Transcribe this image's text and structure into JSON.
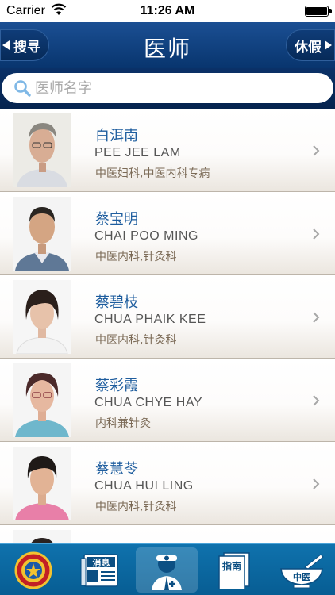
{
  "status_bar": {
    "carrier": "Carrier",
    "time": "11:26 AM"
  },
  "nav": {
    "title": "医师",
    "left_button": "搜寻",
    "right_button": "休假"
  },
  "search": {
    "placeholder": "医师名字",
    "value": ""
  },
  "doctors": [
    {
      "name": "白洱南",
      "pinyin": "PEE JEE LAM",
      "specialty": "中医妇科,中医内科专病"
    },
    {
      "name": "蔡宝明",
      "pinyin": "CHAI POO MING",
      "specialty": "中医内科,针灸科"
    },
    {
      "name": "蔡碧枝",
      "pinyin": "CHUA PHAIK KEE",
      "specialty": "中医内科,针灸科"
    },
    {
      "name": "蔡彩霞",
      "pinyin": "CHUA CHYE HAY",
      "specialty": "内科兼针灸"
    },
    {
      "name": "蔡慧苓",
      "pinyin": "CHUA HUI LING",
      "specialty": "中医内科,针灸科"
    }
  ],
  "tab_bar": {
    "tabs": [
      {
        "icon": "emblem-icon",
        "label": ""
      },
      {
        "icon": "news-icon",
        "label": "消息"
      },
      {
        "icon": "doctor-icon",
        "label": ""
      },
      {
        "icon": "guide-icon",
        "label": "指南"
      },
      {
        "icon": "herb-bowl-icon",
        "label": "中医"
      }
    ],
    "active_index": 2
  },
  "colors": {
    "nav_bar": "#0d417f",
    "tab_bar": "#0a67a0",
    "name_text": "#1e5d9e",
    "specialty_text": "#7b6a56"
  }
}
